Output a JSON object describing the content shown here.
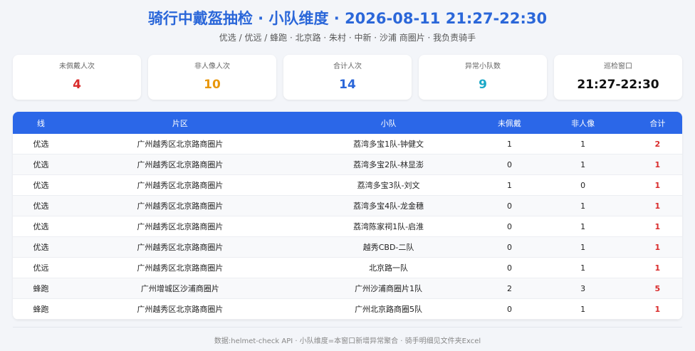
{
  "header": {
    "title": "骑行中戴盔抽检 · 小队维度 · 2026-08-11 21:27-22:30",
    "subtitle": "优选 / 优远 / 蜂跑 · 北京路 · 朱村 · 中新 · 沙浦 商圈片 · 我负责骑手"
  },
  "cards": [
    {
      "label": "未佩戴人次",
      "value": "4",
      "color": "#d92b2b"
    },
    {
      "label": "非人像人次",
      "value": "10",
      "color": "#e8970c"
    },
    {
      "label": "合计人次",
      "value": "14",
      "color": "#2b67d9"
    },
    {
      "label": "异常小队数",
      "value": "9",
      "color": "#19a8c7"
    },
    {
      "label": "巡检窗口",
      "value": "21:27-22:30",
      "color": "#111111"
    }
  ],
  "table": {
    "headers": {
      "line": "线",
      "area": "片区",
      "team": "小队",
      "unhelmet": "未佩戴",
      "nonhuman": "非人像",
      "total": "合计"
    },
    "rows": [
      {
        "line": "优选",
        "area": "广州越秀区北京路商圈片",
        "team": "荔湾多宝1队-钟健文",
        "unhelmet": "1",
        "nonhuman": "1",
        "total": "2"
      },
      {
        "line": "优选",
        "area": "广州越秀区北京路商圈片",
        "team": "荔湾多宝2队-林显澎",
        "unhelmet": "0",
        "nonhuman": "1",
        "total": "1"
      },
      {
        "line": "优选",
        "area": "广州越秀区北京路商圈片",
        "team": "荔湾多宝3队-刘文",
        "unhelmet": "1",
        "nonhuman": "0",
        "total": "1"
      },
      {
        "line": "优选",
        "area": "广州越秀区北京路商圈片",
        "team": "荔湾多宝4队-龙金穗",
        "unhelmet": "0",
        "nonhuman": "1",
        "total": "1"
      },
      {
        "line": "优选",
        "area": "广州越秀区北京路商圈片",
        "team": "荔湾陈家祠1队-启淮",
        "unhelmet": "0",
        "nonhuman": "1",
        "total": "1"
      },
      {
        "line": "优选",
        "area": "广州越秀区北京路商圈片",
        "team": "越秀CBD-二队",
        "unhelmet": "0",
        "nonhuman": "1",
        "total": "1"
      },
      {
        "line": "优远",
        "area": "广州越秀区北京路商圈片",
        "team": "北京路一队",
        "unhelmet": "0",
        "nonhuman": "1",
        "total": "1"
      },
      {
        "line": "蜂跑",
        "area": "广州增城区沙浦商圈片",
        "team": "广州沙浦商圈片1队",
        "unhelmet": "2",
        "nonhuman": "3",
        "total": "5"
      },
      {
        "line": "蜂跑",
        "area": "广州越秀区北京路商圈片",
        "team": "广州北京路商圈5队",
        "unhelmet": "0",
        "nonhuman": "1",
        "total": "1"
      }
    ]
  },
  "footer": {
    "text": "数据:helmet-check API · 小队维度=本窗口新增异常聚合 · 骑手明细见文件夹Excel"
  }
}
